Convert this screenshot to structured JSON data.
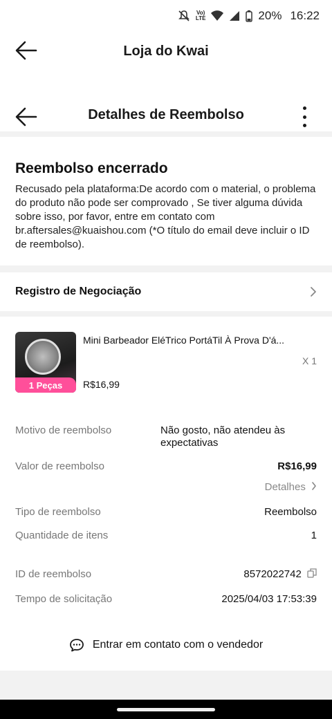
{
  "status_bar": {
    "battery": "20%",
    "time": "16:22",
    "network_top": "Vo)",
    "network_bottom": "LTE"
  },
  "topbar": {
    "title": "Loja do Kwai"
  },
  "subbar": {
    "title": "Detalhes de Reembolso"
  },
  "status_card": {
    "heading": "Reembolso encerrado",
    "description": "Recusado pela plataforma:De acordo com o material, o problema do produto não pode ser comprovado , Se tiver alguma dúvida sobre isso, por favor, entre em contato com br.aftersales@kuaishou.com (*O título do email deve incluir o ID de reembolso)."
  },
  "negotiation": {
    "label": "Registro de Negociação"
  },
  "product": {
    "name": "Mini Barbeador EléTrico PortáTil À Prova D'á...",
    "quantity": "X 1",
    "price": "R$16,99",
    "badge": "1 Peças"
  },
  "details": {
    "motivo_label": "Motivo de reembolso",
    "motivo_value": "Não gosto, não atendeu às expectativas",
    "valor_label": "Valor de reembolso",
    "valor_value": "R$16,99",
    "detalhes_link": "Detalhes",
    "tipo_label": "Tipo de reembolso",
    "tipo_value": "Reembolso",
    "qtd_label": "Quantidade de itens",
    "qtd_value": "1",
    "id_label": "ID de reembolso",
    "id_value": "8572022742",
    "tempo_label": "Tempo de solicitação",
    "tempo_value": "2025/04/03 17:53:39"
  },
  "contact": {
    "label": "Entrar em contato com o vendedor"
  }
}
